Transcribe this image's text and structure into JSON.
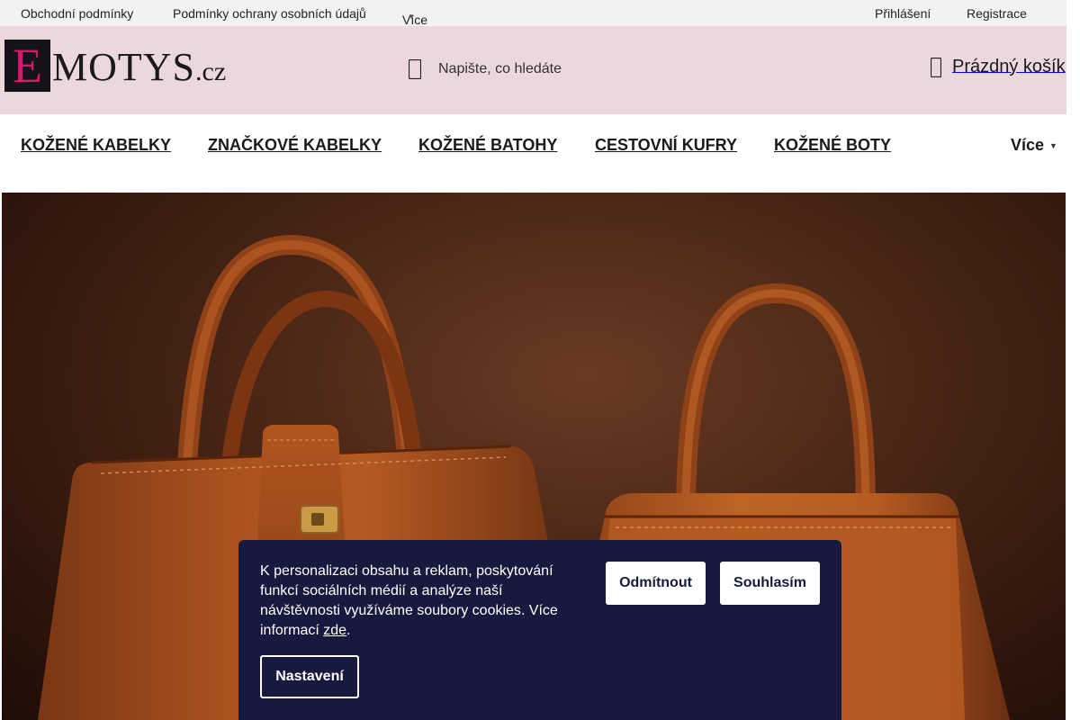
{
  "topbar": {
    "links": [
      "Obchodní podmínky",
      "Podmínky ochrany osobních údajů"
    ],
    "more_label": "Více",
    "login_label": "Přihlášení",
    "register_label": "Registrace"
  },
  "header": {
    "logo_text": "EMOTYS.cz",
    "logo_letter": "E",
    "logo_word": "MOTYS",
    "logo_tld": ".cz",
    "search_placeholder": "Napište, co hledáte",
    "cart_label": "Prázdný košík"
  },
  "nav": {
    "items": [
      "KOŽENÉ KABELKY",
      "ZNAČKOVÉ KABELKY",
      "KOŽENÉ BATOHY",
      "CESTOVNÍ KUFRY",
      "KOŽENÉ BOTY"
    ],
    "more_label": "Více"
  },
  "cookie": {
    "text": "K personalizaci obsahu a reklam, poskytování funkcí sociálních médií a analýze naší návštěvnosti využíváme soubory cookies. Více informací ",
    "link_text": "zde",
    "text_end": ".",
    "reject_label": "Odmítnout",
    "accept_label": "Souhlasím",
    "settings_label": "Nastavení"
  },
  "colors": {
    "header_bg": "#ead8dc",
    "topbar_bg": "#f2f2f2",
    "cookie_bg": "#171a3e",
    "logo_accent": "#d41a6c"
  },
  "icons": {
    "search": "search-icon",
    "cart": "cart-icon",
    "chevron": "chevron-down-icon"
  }
}
